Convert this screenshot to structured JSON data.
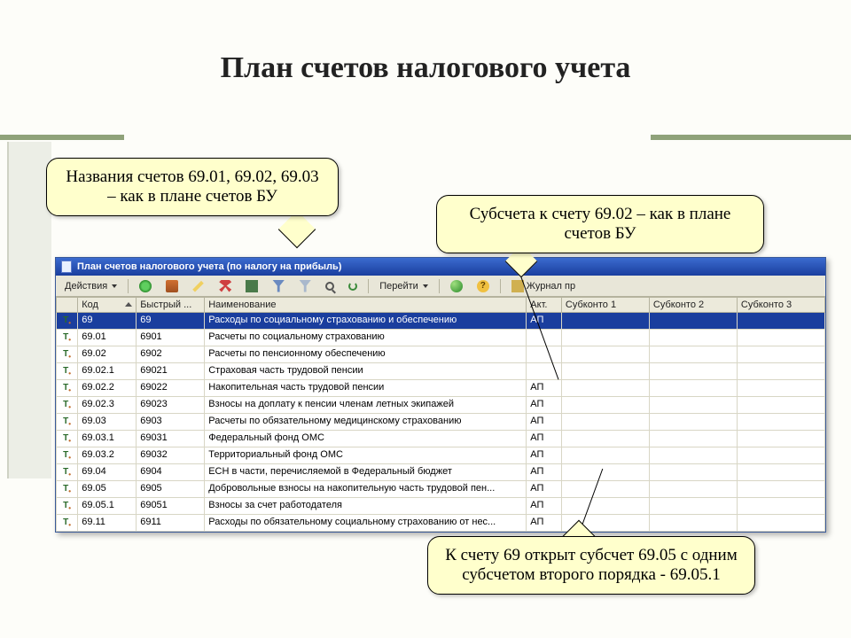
{
  "slide": {
    "title": "План счетов налогового учета"
  },
  "callouts": {
    "c1": "Названия счетов 69.01, 69.02, 69.03 – как в плане счетов БУ",
    "c2": "Субсчета к счету 69.02 – как в плане счетов БУ",
    "c3": "К счету 69 открыт субсчет 69.05 с одним субсчетом второго порядка - 69.05.1"
  },
  "window": {
    "title": "План счетов налогового учета (по налогу на прибыль)"
  },
  "toolbar": {
    "actions": "Действия",
    "goto": "Перейти",
    "journal": "Журнал пр"
  },
  "headers": {
    "code": "Код",
    "quick": "Быстрый ...",
    "name": "Наименование",
    "akt": "Акт.",
    "sk1": "Субконто 1",
    "sk2": "Субконто 2",
    "sk3": "Субконто 3"
  },
  "rows": [
    {
      "code": "69",
      "quick": "69",
      "name": "Расходы по социальному страхованию и обеспечению",
      "akt": "АП"
    },
    {
      "code": "69.01",
      "quick": "6901",
      "name": "Расчеты по социальному страхованию",
      "akt": ""
    },
    {
      "code": "69.02",
      "quick": "6902",
      "name": "Расчеты по пенсионному обеспечению",
      "akt": ""
    },
    {
      "code": "69.02.1",
      "quick": "69021",
      "name": "Страховая часть трудовой пенсии",
      "akt": ""
    },
    {
      "code": "69.02.2",
      "quick": "69022",
      "name": "Накопительная часть трудовой пенсии",
      "akt": "АП"
    },
    {
      "code": "69.02.3",
      "quick": "69023",
      "name": "Взносы на доплату к пенсии членам летных экипажей",
      "akt": "АП"
    },
    {
      "code": "69.03",
      "quick": "6903",
      "name": "Расчеты по обязательному медицинскому страхованию",
      "akt": "АП"
    },
    {
      "code": "69.03.1",
      "quick": "69031",
      "name": "Федеральный фонд ОМС",
      "akt": "АП"
    },
    {
      "code": "69.03.2",
      "quick": "69032",
      "name": "Территориальный фонд ОМС",
      "akt": "АП"
    },
    {
      "code": "69.04",
      "quick": "6904",
      "name": "ЕСН в части, перечисляемой в Федеральный бюджет",
      "akt": "АП"
    },
    {
      "code": "69.05",
      "quick": "6905",
      "name": "Добровольные взносы на накопительную часть трудовой пен...",
      "akt": "АП"
    },
    {
      "code": "69.05.1",
      "quick": "69051",
      "name": "Взносы за счет работодателя",
      "akt": "АП"
    },
    {
      "code": "69.11",
      "quick": "6911",
      "name": "Расходы по обязательному социальному страхованию от нес...",
      "akt": "АП"
    }
  ]
}
